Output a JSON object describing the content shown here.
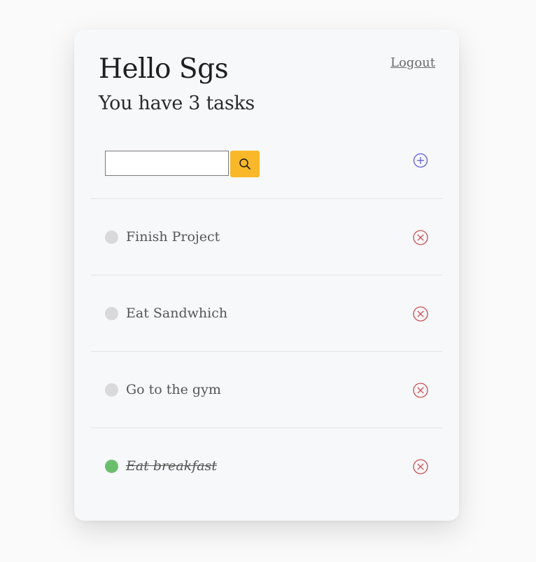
{
  "header": {
    "greeting": "Hello Sgs",
    "subtitle": "You have 3 tasks",
    "logout_label": "Logout"
  },
  "search": {
    "value": "",
    "placeholder": "",
    "button_icon": "search-icon"
  },
  "add_button_icon": "plus-circle-icon",
  "tasks": [
    {
      "text": "Finish Project",
      "completed": false
    },
    {
      "text": "Eat Sandwhich",
      "completed": false
    },
    {
      "text": "Go to the gym",
      "completed": false
    },
    {
      "text": "Eat breakfast",
      "completed": true
    }
  ],
  "colors": {
    "accent_search": "#f9b82a",
    "add_icon": "#5b5bd6",
    "delete_icon": "#c94b4b",
    "status_pending": "#d9d9db",
    "status_done": "#6bbf6c"
  }
}
